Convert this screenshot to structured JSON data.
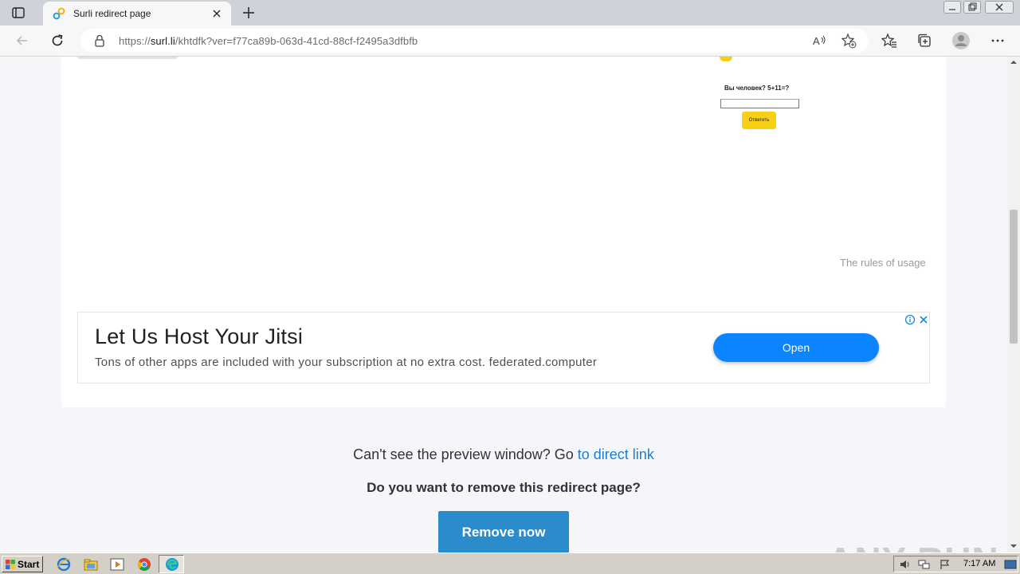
{
  "browser": {
    "tab_title": "Surli redirect page",
    "url_prefix": "https://",
    "url_host": "surl.li",
    "url_path": "/khtdfk?ver=f77ca89b-063d-41cd-88cf-f2495a3dfbfb",
    "icons": [
      "tab-menu-icon",
      "favicon-link-icon",
      "close-icon",
      "plus-icon",
      "back-arrow-icon",
      "refresh-icon",
      "lock-icon",
      "read-aloud-icon",
      "add-favorite-icon",
      "favorites-icon",
      "collections-icon",
      "profile-icon",
      "more-icon"
    ]
  },
  "page": {
    "captcha_question": "Вы человек? 5+11=?",
    "captcha_button": "Ответить",
    "rules_link": "The rules of usage",
    "ad": {
      "title": "Let Us Host Your Jitsi",
      "description": "Tons of other apps are included with your subscription at no extra cost. federated.computer",
      "open_label": "Open"
    },
    "cant_see_text": "Can't see the preview window? Go",
    "direct_link": "to direct link",
    "remove_question": "Do you want to remove this redirect page?",
    "remove_button": "Remove now"
  },
  "watermark": "ANY RUN",
  "taskbar": {
    "start_label": "Start",
    "clock": "7:17 AM"
  },
  "colors": {
    "accent_blue": "#2b8ccb",
    "link_blue": "#1a7fd4",
    "ad_button": "#0a84ff",
    "captcha_yellow": "#f7d016"
  }
}
